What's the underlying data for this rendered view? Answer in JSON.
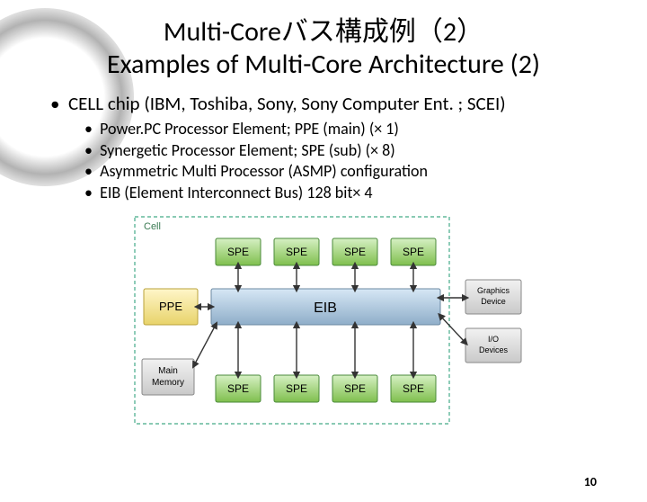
{
  "title_line1": "Multi-Coreバス構成例（2）",
  "title_line2": "Examples of Multi-Core Architecture (2)",
  "bullet_main": "CELL chip (IBM, Toshiba, Sony, Sony Computer Ent. ; SCEI)",
  "sub_bullets": [
    "Power.PC Processor Element; PPE (main) (× 1)",
    "Synergetic Processor Element; SPE (sub) (× 8)",
    "Asymmetric Multi Processor (ASMP) configuration",
    "EIB (Element Interconnect Bus)  128 bit× 4"
  ],
  "diagram": {
    "container_label": "Cell",
    "ppe": "PPE",
    "spe": "SPE",
    "eib": "EIB",
    "mem": "Main\nMemory",
    "gpu": "Graphics\nDevice",
    "io": "I/O\nDevices"
  },
  "page_number": "10"
}
